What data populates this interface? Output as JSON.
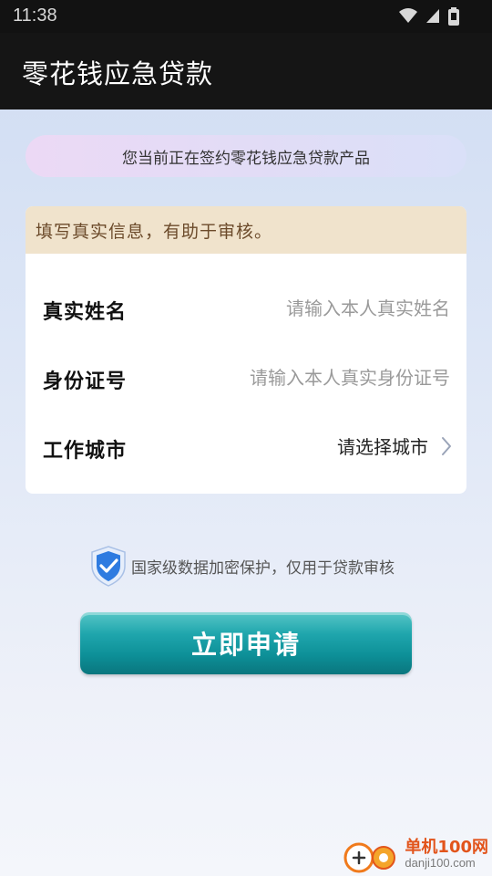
{
  "status_bar": {
    "time": "11:38"
  },
  "app_bar": {
    "title": "零花钱应急贷款"
  },
  "banner": {
    "text": "您当前正在签约零花钱应急贷款产品"
  },
  "form": {
    "notice": "填写真实信息，有助于审核。",
    "name": {
      "label": "真实姓名",
      "placeholder": "请输入本人真实姓名"
    },
    "id_number": {
      "label": "身份证号",
      "placeholder": "请输入本人真实身份证号"
    },
    "city": {
      "label": "工作城市",
      "value": "请选择城市"
    }
  },
  "security_note": "国家级数据加密保护，仅用于贷款审核",
  "apply_button": "立即申请",
  "watermark": {
    "title": "单机100网",
    "url": "danji100.com"
  },
  "colors": {
    "header": "#151515",
    "button": "#1fa6ad",
    "notice_bg": "#f0e3cc",
    "notice_text": "#6b4a2a",
    "watermark": "#e2541b"
  }
}
